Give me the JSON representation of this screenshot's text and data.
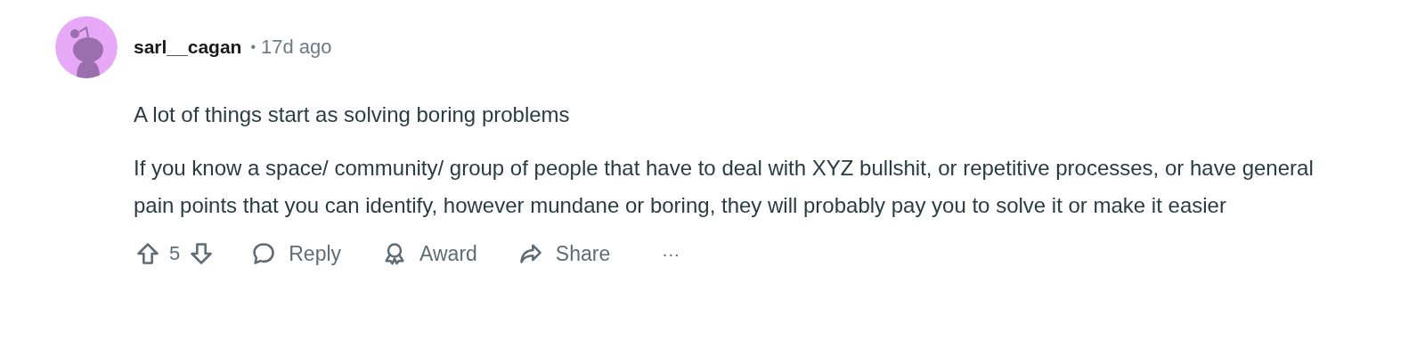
{
  "comment": {
    "author": "sarl__cagan",
    "separator": "•",
    "time": "17d ago",
    "paragraphs": [
      "A lot of things start as solving boring problems",
      "If you know a space/ community/ group of people that have to deal with XYZ bullshit, or repetitive processes, or have general pain points that you can identify, however mundane or boring, they will probably pay you to solve it or make it easier"
    ],
    "score": "5",
    "actions": [
      {
        "kind": "reply",
        "label": "Reply"
      },
      {
        "kind": "award",
        "label": "Award"
      },
      {
        "kind": "share",
        "label": "Share"
      },
      {
        "kind": "more",
        "label": "···"
      }
    ]
  }
}
